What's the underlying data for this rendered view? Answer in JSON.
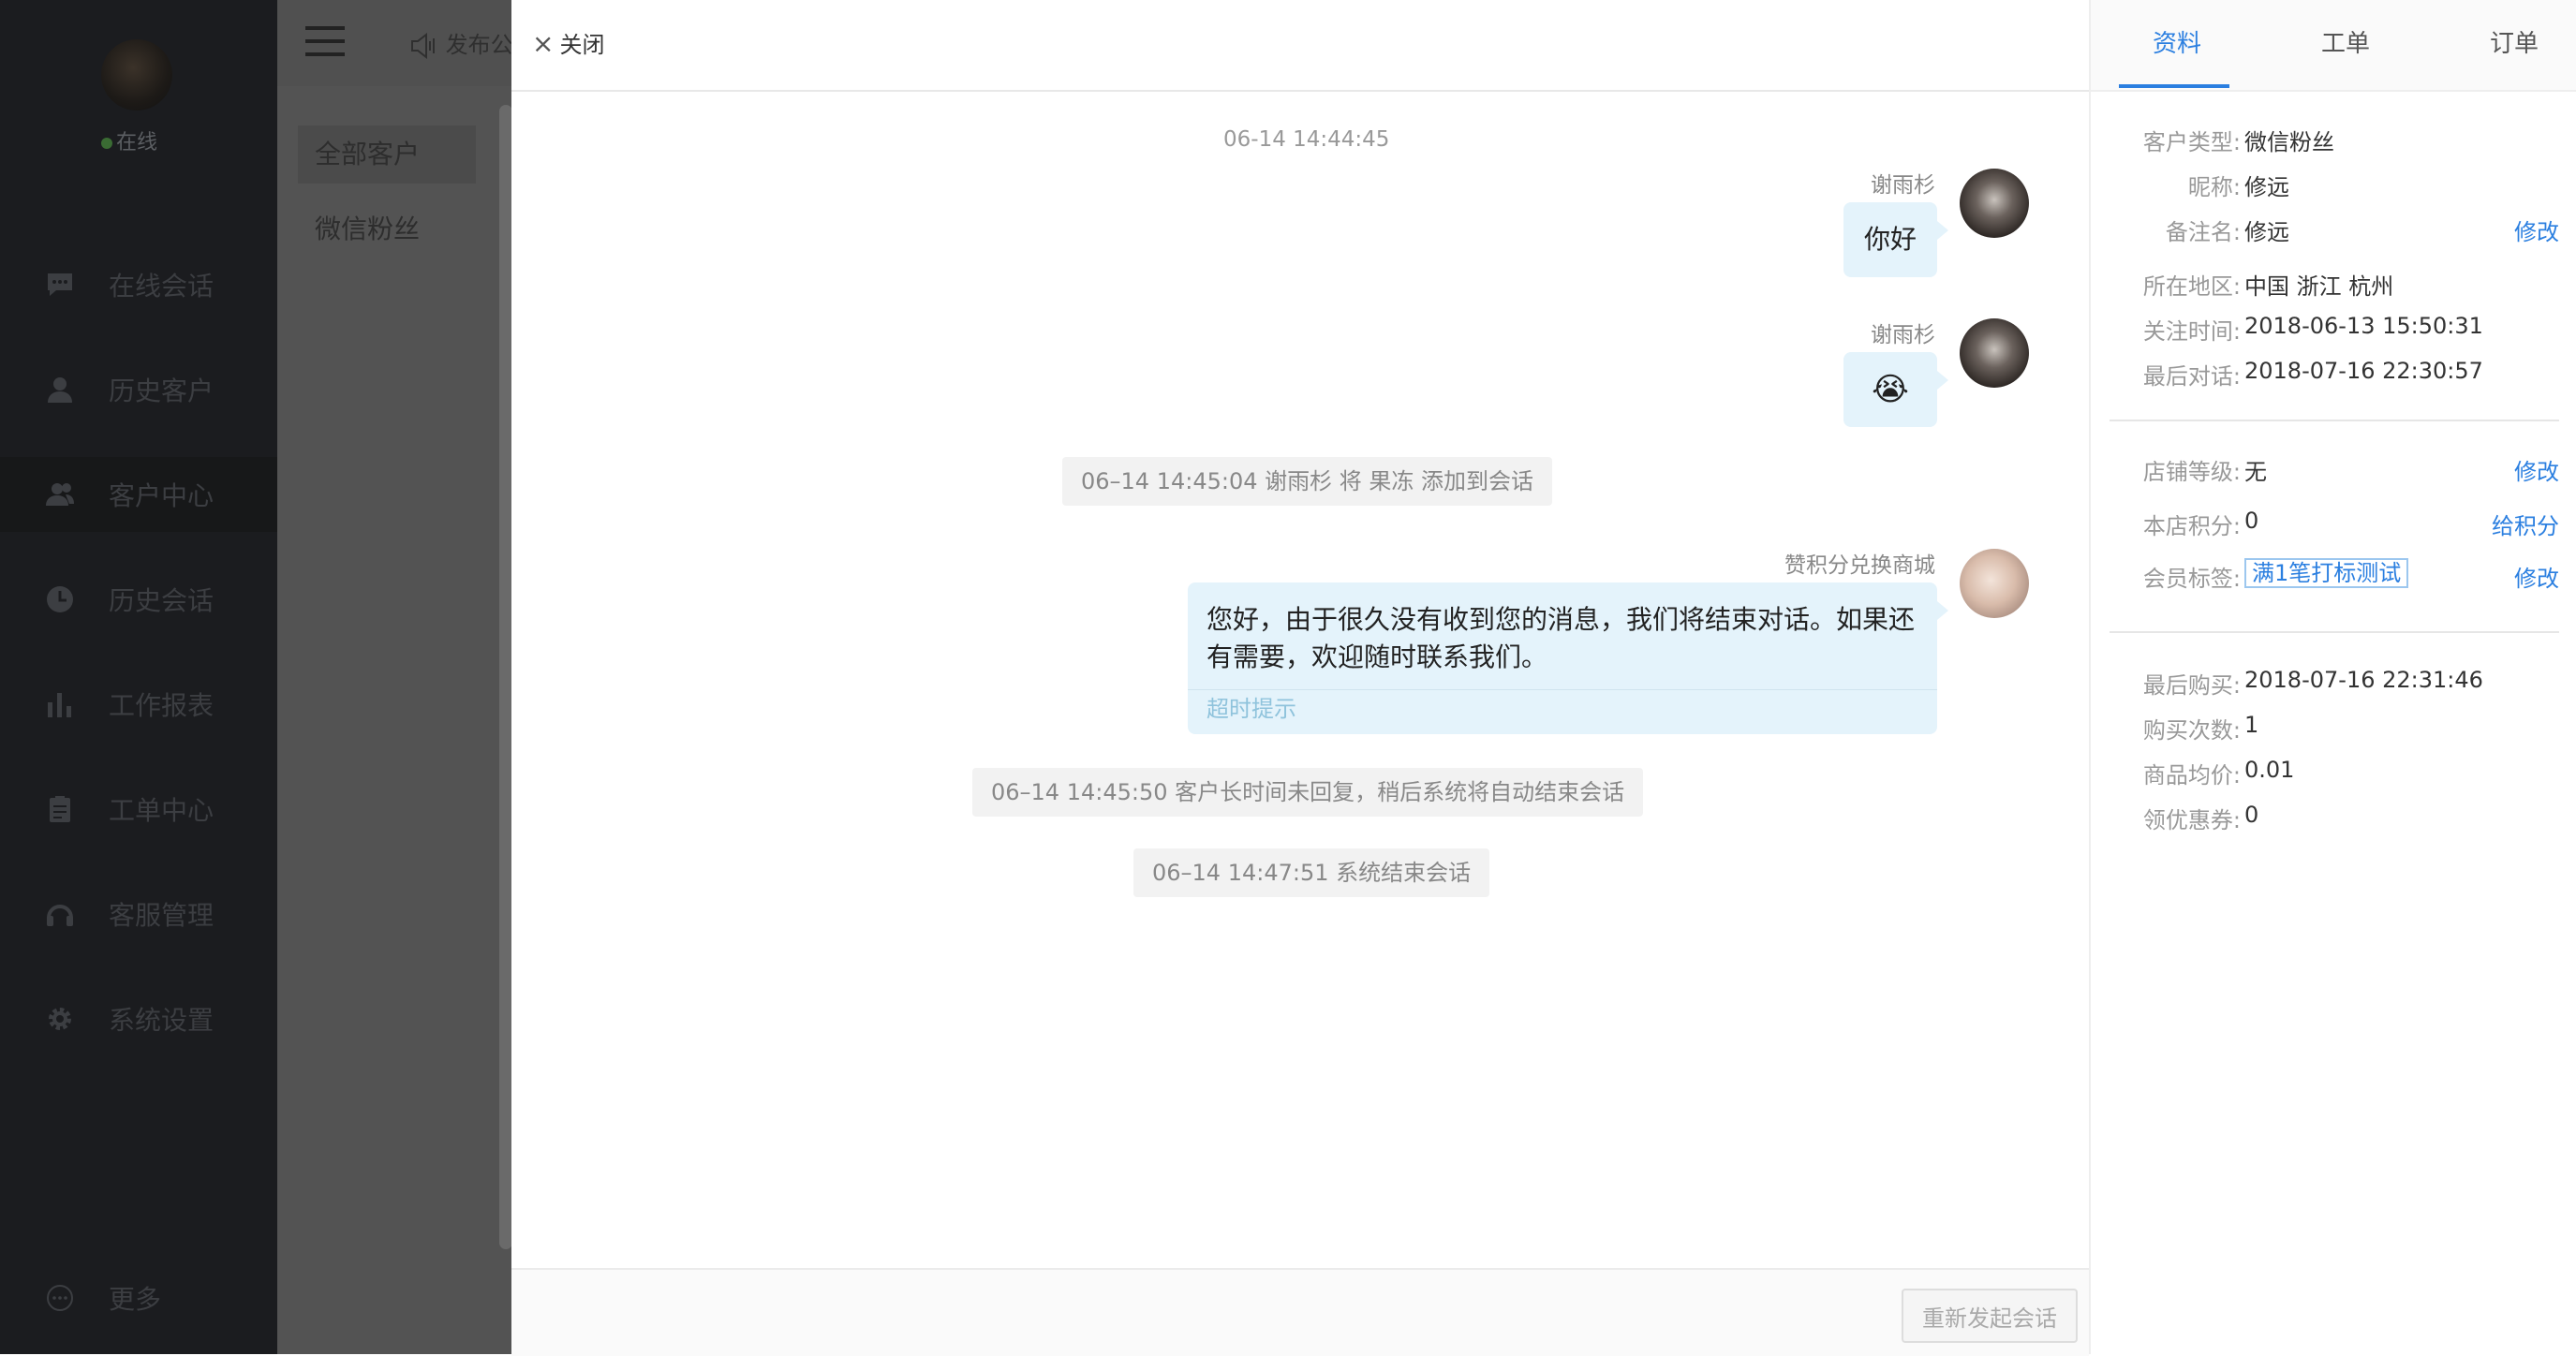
{
  "nav": {
    "status": "在线",
    "items": [
      {
        "label": "在线会话",
        "icon": "chat-bubble-icon"
      },
      {
        "label": "历史客户",
        "icon": "user-icon"
      },
      {
        "label": "客户中心",
        "icon": "users-icon"
      },
      {
        "label": "历史会话",
        "icon": "clock-icon"
      },
      {
        "label": "工作报表",
        "icon": "bar-chart-icon"
      },
      {
        "label": "工单中心",
        "icon": "clipboard-icon"
      },
      {
        "label": "客服管理",
        "icon": "headset-icon"
      },
      {
        "label": "系统设置",
        "icon": "gear-icon"
      }
    ],
    "more": "更多"
  },
  "col2": {
    "announce": "发布公",
    "items": [
      "全部客户",
      "微信粉丝"
    ]
  },
  "chat": {
    "close_label": "关闭",
    "timestamp": "06-14 14:44:45",
    "messages": [
      {
        "sender": "谢雨杉",
        "text": "你好"
      },
      {
        "sender": "谢雨杉",
        "emoji": "😭"
      },
      {
        "sender": "赞积分兑换商城",
        "text": "您好，由于很久没有收到您的消息，我们将结束对话。如果还有需要，欢迎随时联系我们。",
        "tip": "超时提示"
      }
    ],
    "system_messages": [
      "06–14 14:45:04 谢雨杉 将 果冻 添加到会话",
      "06–14 14:45:50 客户长时间未回复，稍后系统将自动结束会话",
      "06–14 14:47:51 系统结束会话"
    ],
    "restart_label": "重新发起会话"
  },
  "info": {
    "tabs": [
      "资料",
      "工单",
      "订单"
    ],
    "active_tab": 0,
    "basic": [
      {
        "key": "客户类型:",
        "value": "微信粉丝"
      },
      {
        "key": "昵称:",
        "value": "修远"
      },
      {
        "key": "备注名:",
        "value": "修远",
        "action": "修改"
      },
      {
        "key": "所在地区:",
        "value": "中国 浙江 杭州"
      },
      {
        "key": "关注时间:",
        "value": "2018-06-13 15:50:31"
      },
      {
        "key": "最后对话:",
        "value": "2018-07-16 22:30:57"
      }
    ],
    "member": [
      {
        "key": "店铺等级:",
        "value": "无",
        "action": "修改"
      },
      {
        "key": "本店积分:",
        "value": "0",
        "action": "给积分"
      },
      {
        "key": "会员标签:",
        "tag": "满1笔打标测试",
        "action": "修改"
      }
    ],
    "purchase": [
      {
        "key": "最后购买:",
        "value": "2018-07-16 22:31:46"
      },
      {
        "key": "购买次数:",
        "value": "1"
      },
      {
        "key": "商品均价:",
        "value": "0.01"
      },
      {
        "key": "领优惠券:",
        "value": "0"
      }
    ]
  },
  "colors": {
    "accent": "#2b7fe0",
    "bubble": "#e4f3fb",
    "nav_bg": "#1b1c1f",
    "system_bg": "#f2f2f2"
  }
}
